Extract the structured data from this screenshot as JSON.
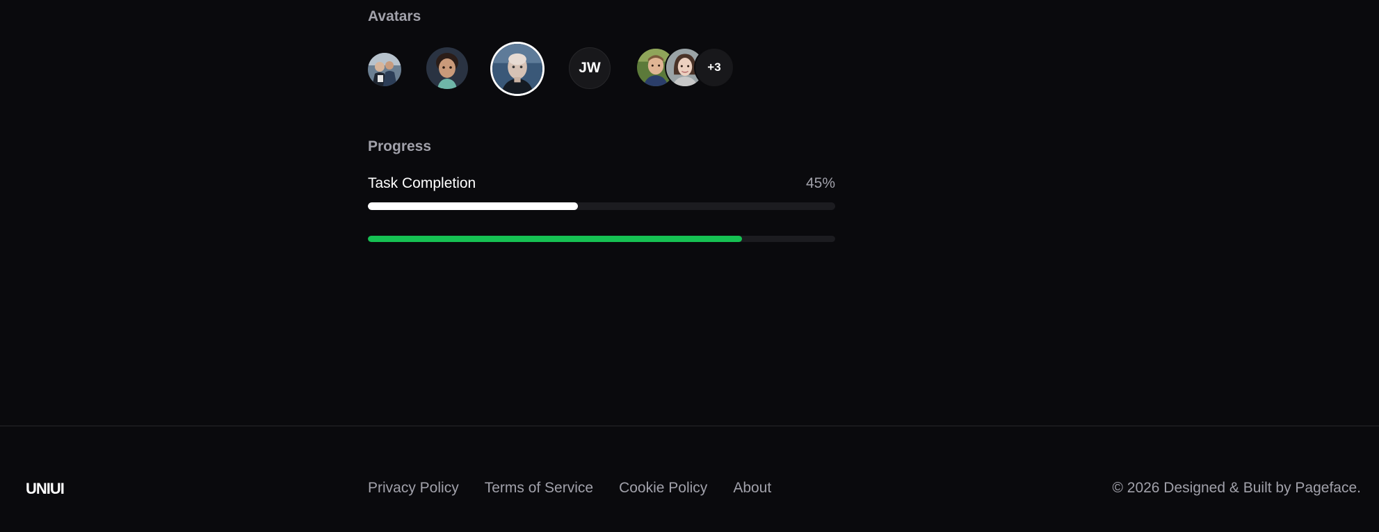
{
  "avatars": {
    "title": "Avatars",
    "initials": "JW",
    "group_overflow": "+3"
  },
  "progress": {
    "title": "Progress",
    "task": {
      "label": "Task Completion",
      "value_text": "45%",
      "value": 0.45,
      "color": "#ffffff"
    },
    "secondary": {
      "value": 0.8,
      "color": "#16c153"
    },
    "track_color": "#1c1c20"
  },
  "footer": {
    "logo": "UNIUI",
    "links": [
      "Privacy Policy",
      "Terms of Service",
      "Cookie Policy",
      "About"
    ],
    "copyright": "© 2026 Designed & Built by Pageface."
  }
}
